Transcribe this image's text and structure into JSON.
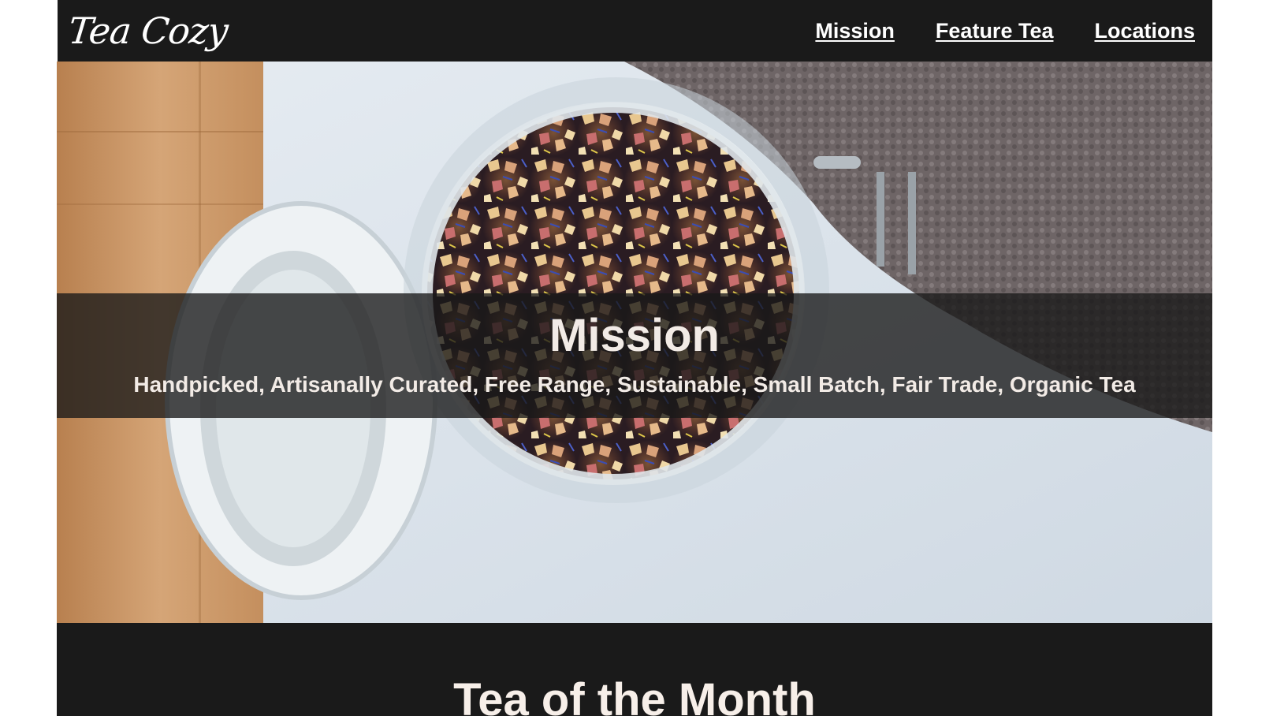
{
  "header": {
    "logo_text": "Tea Cozy",
    "nav": [
      {
        "label": "Mission"
      },
      {
        "label": "Feature Tea"
      },
      {
        "label": "Locations"
      }
    ]
  },
  "hero": {
    "image_subject": "open glass jar of loose-leaf fruit tea on a white surface with wooden board and grey knit fabric",
    "mission_title": "Mission",
    "mission_text": "Handpicked, Artisanally Curated, Free Range, Sustainable, Small Batch, Fair Trade, Organic Tea"
  },
  "tea_of_month": {
    "title": "Tea of the Month"
  },
  "colors": {
    "header_bg": "#1a1a1a",
    "text_light": "#f2ebe6",
    "band_bg": "rgba(24,24,24,0.78)"
  }
}
